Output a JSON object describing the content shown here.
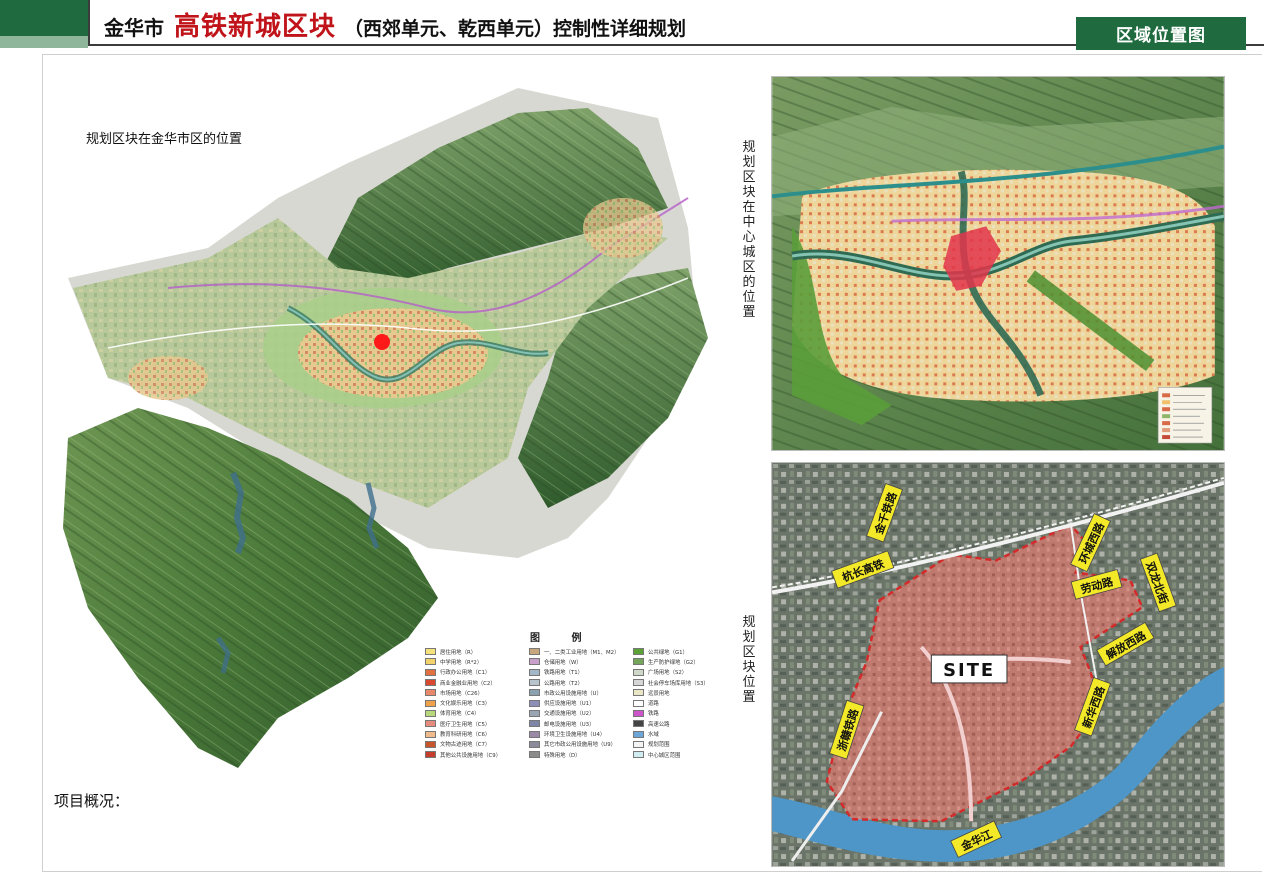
{
  "header": {
    "city": "金华市",
    "block": "高铁新城区块",
    "subtitle": "（西郊单元、乾西单元）控制性详细规划",
    "tag": "区域位置图"
  },
  "left_panel": {
    "caption": "规划区块在金华市区的位置",
    "project_label": "项目概况："
  },
  "legend": {
    "title": "图 例",
    "col1": [
      {
        "label": "居住用地（R）",
        "color": "#f5e27a"
      },
      {
        "label": "中学用地（R*2）",
        "color": "#f2d36b"
      },
      {
        "label": "行政办公用地（C1）",
        "color": "#e3703f"
      },
      {
        "label": "商业金融业用地（C2）",
        "color": "#d9492f"
      },
      {
        "label": "市场用地（C26）",
        "color": "#e8896a"
      },
      {
        "label": "文化娱乐用地（C3）",
        "color": "#f0a24a"
      },
      {
        "label": "体育用地（C4）",
        "color": "#b7d87b"
      },
      {
        "label": "医疗卫生用地（C5）",
        "color": "#e68c7f"
      },
      {
        "label": "教育科研用地（C6）",
        "color": "#f0bb8a"
      },
      {
        "label": "文物古迹用地（C7）",
        "color": "#c9552d"
      },
      {
        "label": "其他公共设施用地（C9）",
        "color": "#c53e2c"
      }
    ],
    "col2": [
      {
        "label": "一、二类工业用地（M1、M2）",
        "color": "#c8a77e"
      },
      {
        "label": "仓储用地（W）",
        "color": "#c9a0c9"
      },
      {
        "label": "铁路用地（T1）",
        "color": "#a4b7c6"
      },
      {
        "label": "公路用地（T2）",
        "color": "#b8c4cc"
      },
      {
        "label": "市政公用设施用地（U）",
        "color": "#8aa2b0"
      },
      {
        "label": "供应设施用地（U1）",
        "color": "#8d8fb8"
      },
      {
        "label": "交通设施用地（U2）",
        "color": "#9aa5b4"
      },
      {
        "label": "邮电设施用地（U3）",
        "color": "#7d86a6"
      },
      {
        "label": "环境卫生设施用地（U4）",
        "color": "#9a8aa8"
      },
      {
        "label": "其它市政公用设施用地（U9）",
        "color": "#8a8a9a"
      },
      {
        "label": "特殊用地（D）",
        "color": "#8b8b8b"
      }
    ],
    "col3": [
      {
        "label": "公共绿地（G1）",
        "color": "#5aa236"
      },
      {
        "label": "生产防护绿地（G2）",
        "color": "#74a55a"
      },
      {
        "label": "广场用地（S2）",
        "color": "#cfd8c8"
      },
      {
        "label": "社会停车场库用地（S3）",
        "color": "#d6d6d6"
      },
      {
        "label": "远景用地",
        "color": "#e8e6c4"
      },
      {
        "label": "道路",
        "color": "#ffffff"
      },
      {
        "label": "铁路",
        "color": "#cc55cc"
      },
      {
        "label": "高速公路",
        "color": "#444444"
      },
      {
        "label": "水域",
        "color": "#6aa7d8"
      },
      {
        "label": "规划范围",
        "color": "#f4f4f4"
      },
      {
        "label": "中心城区范围",
        "color": "#d0ecf0"
      }
    ]
  },
  "top_right": {
    "vertical_label": "规划区块在中心城区的位置"
  },
  "bottom_right": {
    "vertical_label": "规划区块位置",
    "site_label": "SITE",
    "roads": [
      "金千铁路",
      "杭长高铁",
      "环城西路",
      "劳动路",
      "双龙北街",
      "解放西路",
      "新华西路",
      "浙赣铁路",
      "金华江"
    ]
  },
  "colors": {
    "brand_green": "#1f6b3f",
    "title_red": "#c0141a",
    "road_tag_yellow": "#f3e928",
    "site_fill": "#c8736e",
    "boundary_red": "#d42a2a"
  }
}
